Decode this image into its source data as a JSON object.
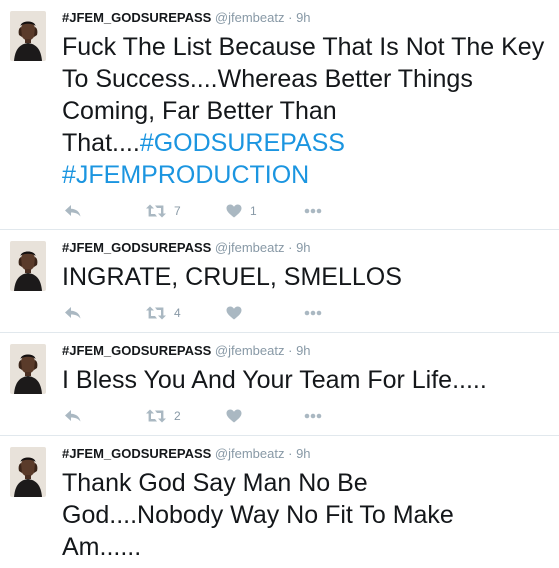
{
  "colors": {
    "hashtag": "#1b95e0",
    "icon": "#aab8c2",
    "meta": "#8899a6"
  },
  "tweets": [
    {
      "name": "#JFEM_GODSUREPASS",
      "handle": "@jfembeatz",
      "separator": "·",
      "time": "9h",
      "text_plain": "Fuck The List Because That Is Not The Key To Success....Whereas Better Things Coming, Far Better Than That....",
      "hashtag1": "#GODSUREPASS",
      "hashtag2": "#JFEMPRODUCTION",
      "retweets": "7",
      "likes": "1",
      "icons": [
        "reply-icon",
        "retweet-icon",
        "heart-icon",
        "more-icon"
      ]
    },
    {
      "name": "#JFEM_GODSUREPASS",
      "handle": "@jfembeatz",
      "separator": "·",
      "time": "9h",
      "text_plain": "INGRATE, CRUEL, SMELLOS",
      "retweets": "4",
      "likes": "",
      "icons": [
        "reply-icon",
        "retweet-icon",
        "heart-icon",
        "more-icon"
      ]
    },
    {
      "name": "#JFEM_GODSUREPASS",
      "handle": "@jfembeatz",
      "separator": "·",
      "time": "9h",
      "text_plain": "I Bless You And Your Team For Life.....",
      "retweets": "2",
      "likes": "",
      "icons": [
        "reply-icon",
        "retweet-icon",
        "heart-icon",
        "more-icon"
      ]
    },
    {
      "name": "#JFEM_GODSUREPASS",
      "handle": "@jfembeatz",
      "separator": "·",
      "time": "9h",
      "text_plain": "Thank God Say Man No Be God....Nobody Way No Fit To Make Am......"
    }
  ]
}
